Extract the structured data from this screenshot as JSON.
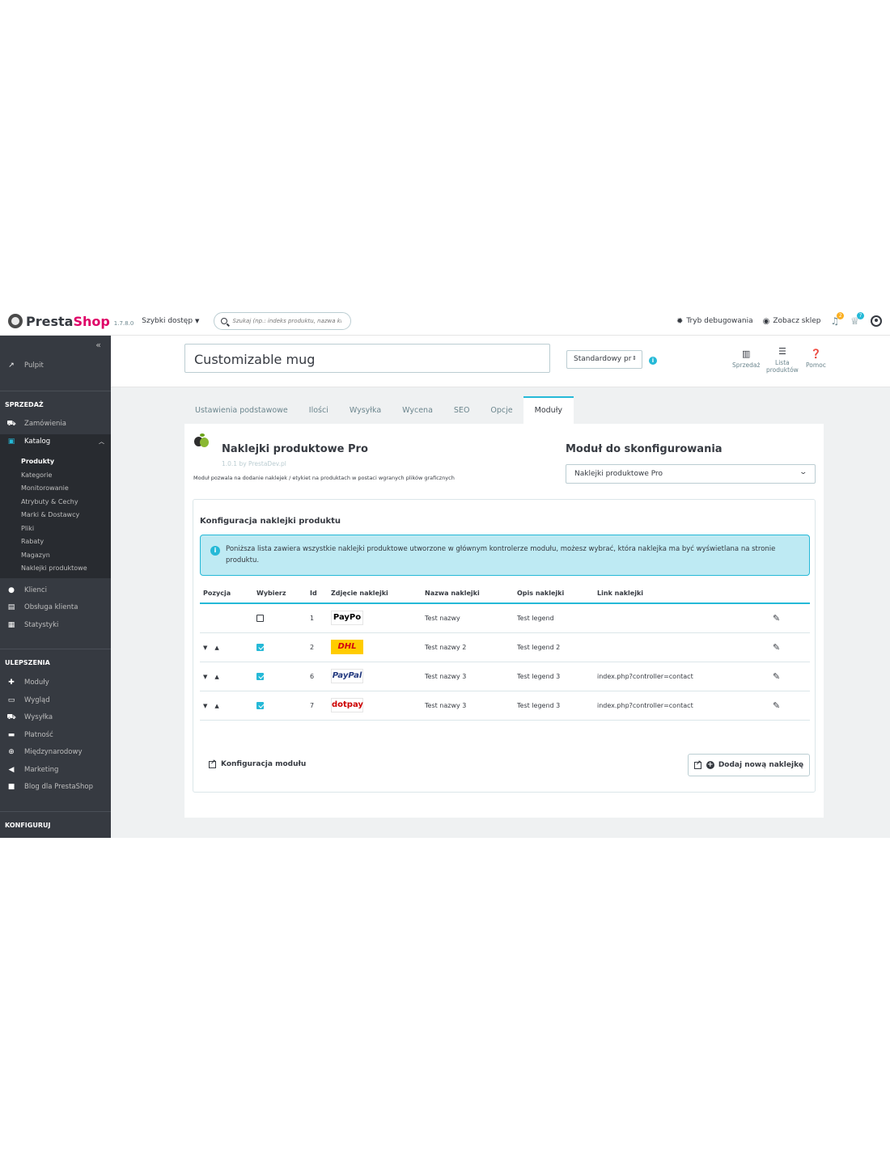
{
  "header": {
    "logo_presta": "Presta",
    "logo_shop": "Shop",
    "version": "1.7.8.0",
    "quick_access": "Szybki dostęp",
    "search_placeholder": "Szukaj (np.: indeks produktu, nazwa kl",
    "debug": "Tryb debugowania",
    "view_shop": "Zobacz sklep",
    "notif1_count": "2",
    "notif2_count": "7",
    "notif1_color": "#fbaf21",
    "notif2_color": "#25b9d7"
  },
  "sidebar": {
    "dashboard": "Pulpit",
    "sell_section": "SPRZEDAŻ",
    "orders": "Zamówienia",
    "catalog": "Katalog",
    "catalog_sub": [
      "Produkty",
      "Kategorie",
      "Monitorowanie",
      "Atrybuty & Cechy",
      "Marki & Dostawcy",
      "Pliki",
      "Rabaty",
      "Magazyn",
      "Naklejki produktowe"
    ],
    "customers": "Klienci",
    "support": "Obsługa klienta",
    "stats": "Statystyki",
    "improve_section": "ULEPSZENIA",
    "modules": "Moduły",
    "design": "Wygląd",
    "shipping": "Wysyłka",
    "payment": "Płatność",
    "international": "Międzynarodowy",
    "marketing": "Marketing",
    "blog": "Blog dla PrestaShop",
    "configure_section": "KONFIGURUJ"
  },
  "product": {
    "name": "Customizable mug",
    "type": "Standardowy pr",
    "toolbar_sales": "Sprzedaż",
    "toolbar_list_1": "Lista",
    "toolbar_list_2": "produktów",
    "toolbar_help": "Pomoc"
  },
  "tabs": [
    "Ustawienia podstawowe",
    "Ilości",
    "Wysyłka",
    "Wycena",
    "SEO",
    "Opcje",
    "Moduły"
  ],
  "module": {
    "title": "Naklejki produktowe Pro",
    "version": "1.0.1 by PrestaDev.pl",
    "description": "Moduł pozwala na dodanie naklejek / etykiet na produktach w postaci wgranych plików graficznych",
    "config_title": "Moduł do skonfigurowania",
    "config_selected": "Naklejki produktowe Pro"
  },
  "card": {
    "title": "Konfiguracja naklejki produktu",
    "alert": "Poniższa lista zawiera wszystkie naklejki produktowe utworzone w głównym kontrolerze modułu, możesz wybrać, która naklejka ma być wyświetlana na stronie produktu.",
    "columns": [
      "Pozycja",
      "Wybierz",
      "Id",
      "Zdjęcie naklejki",
      "Nazwa naklejki",
      "Opis naklejki",
      "Link naklejki"
    ],
    "rows": [
      {
        "id": "1",
        "checked": false,
        "sticker": "PayPo",
        "sticker_color": "#000000",
        "name": "Test nazwy",
        "desc": "Test legend",
        "link": ""
      },
      {
        "id": "2",
        "checked": true,
        "sticker": "DHL",
        "sticker_color": "#d40511",
        "name": "Test nazwy 2",
        "desc": "Test legend 2",
        "link": ""
      },
      {
        "id": "6",
        "checked": true,
        "sticker": "PayPal",
        "sticker_color": "#253b80",
        "name": "Test nazwy 3",
        "desc": "Test legend 3",
        "link": "index.php?controller=contact"
      },
      {
        "id": "7",
        "checked": true,
        "sticker": "dotpay",
        "sticker_color": "#cc0000",
        "name": "Test nazwy 3",
        "desc": "Test legend 3",
        "link": "index.php?controller=contact"
      }
    ],
    "config_link": "Konfiguracja modułu",
    "add_button": "Dodaj nową naklejkę"
  },
  "colors": {
    "accent": "#25b9d7",
    "sidebar": "#363a41",
    "brand_pink": "#df0067"
  }
}
